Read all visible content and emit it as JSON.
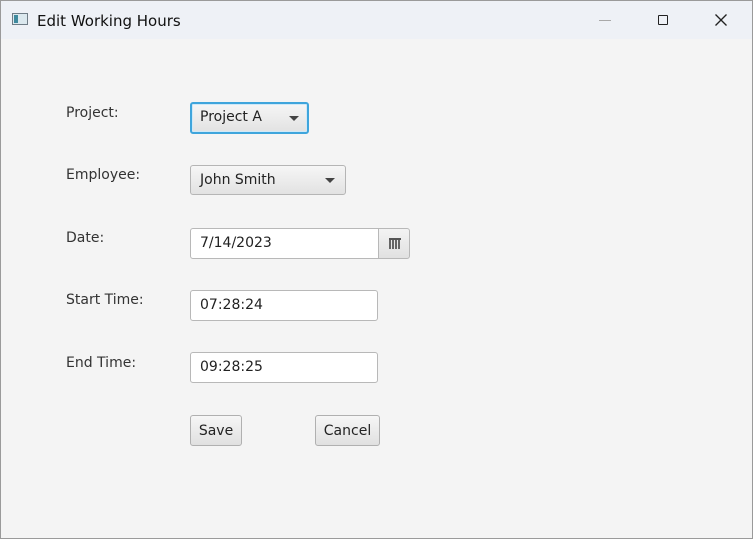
{
  "window": {
    "title": "Edit Working Hours",
    "icons": {
      "app": "app-icon",
      "minimize": "minimize-icon",
      "maximize": "maximize-icon",
      "close": "close-icon"
    }
  },
  "form": {
    "project": {
      "label": "Project:",
      "value": "Project A"
    },
    "employee": {
      "label": "Employee:",
      "value": "John Smith"
    },
    "date": {
      "label": "Date:",
      "value": "7/14/2023",
      "icon": "calendar-icon"
    },
    "start_time": {
      "label": "Start Time:",
      "value": "07:28:24"
    },
    "end_time": {
      "label": "End Time:",
      "value": "09:28:25"
    }
  },
  "actions": {
    "save_label": "Save",
    "cancel_label": "Cancel"
  },
  "colors": {
    "focus": "#3fa5dc",
    "titlebar": "#eef1f6",
    "background": "#f4f4f4"
  }
}
